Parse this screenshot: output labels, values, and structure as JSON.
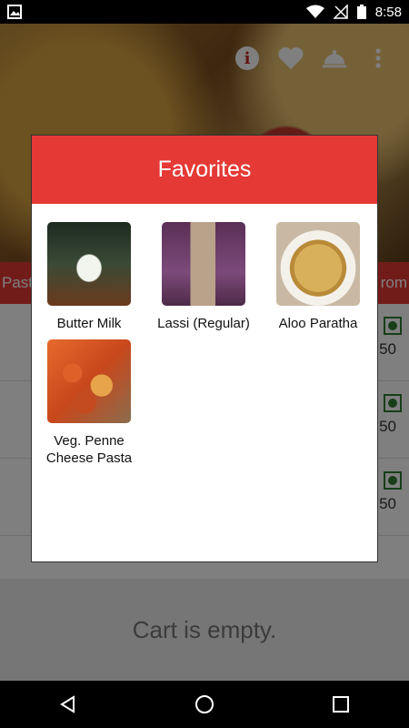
{
  "status_bar": {
    "time": "8:58"
  },
  "background": {
    "category_tabs": [
      "Past",
      "rom"
    ],
    "rows": [
      {
        "price": "50"
      },
      {
        "price": "50"
      },
      {
        "price": "50"
      }
    ],
    "cart_message": "Cart is empty."
  },
  "dialog": {
    "title": "Favorites",
    "items": [
      {
        "name": "Butter Milk"
      },
      {
        "name": "Lassi (Regular)"
      },
      {
        "name": "Aloo Paratha"
      },
      {
        "name": "Veg. Penne Cheese Pasta"
      }
    ]
  },
  "icons": {
    "info": "info-icon",
    "favorite": "heart-icon",
    "order": "cloche-icon",
    "more": "more-vert-icon"
  },
  "colors": {
    "accent": "#e53935",
    "veg": "#2e7d32"
  }
}
